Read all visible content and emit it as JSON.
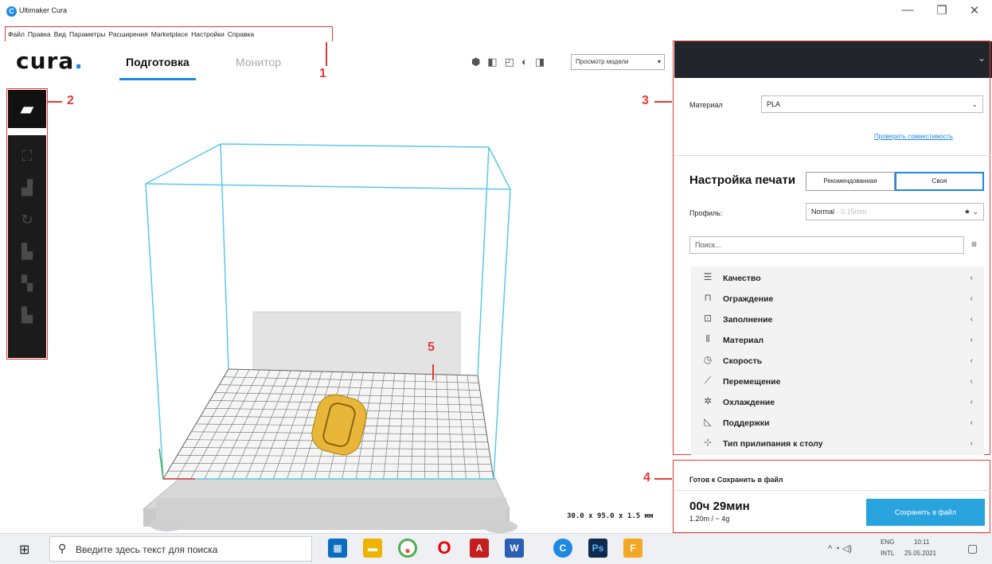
{
  "window": {
    "title": "Ultimaker Cura",
    "app_icon": "cura-icon",
    "controls": {
      "minimize": "—",
      "maximize": "❐",
      "close": "✕"
    }
  },
  "menu": [
    "Файл",
    "Правка",
    "Вид",
    "Параметры",
    "Расширения",
    "Marketplace",
    "Настройки",
    "Справка"
  ],
  "header": {
    "logo": "cura",
    "tabs": [
      {
        "label": "Подготовка",
        "active": true
      },
      {
        "label": "Монитор",
        "active": false
      }
    ],
    "view_icons": [
      "3d-view-icon",
      "front-view-icon",
      "top-view-icon",
      "left-view-icon",
      "right-view-icon"
    ],
    "view_mode": "Просмотр модели"
  },
  "toolbar": [
    "open-file-icon",
    "move-icon",
    "scale-icon",
    "rotate-icon",
    "mirror-icon",
    "per-model-settings-icon",
    "support-blocker-icon"
  ],
  "callouts": [
    "1",
    "2",
    "3",
    "4",
    "5"
  ],
  "model_dimensions": "30.0 x 95.0 x 1.5 мм",
  "printer_panel": {
    "material_label": "Материал",
    "material_value": "PLA",
    "compat_link": "Проверить совместимость"
  },
  "print_settings": {
    "title": "Настройка печати",
    "mode_recommended": "Рекомендованная",
    "mode_custom": "Своя",
    "profile_label": "Профиль:",
    "profile_value": "Normal",
    "profile_detail": "- 0.15mm",
    "search_placeholder": "Поиск...",
    "categories": [
      {
        "label": "Качество",
        "icon": "quality-icon"
      },
      {
        "label": "Ограждение",
        "icon": "shell-icon"
      },
      {
        "label": "Заполнение",
        "icon": "infill-icon"
      },
      {
        "label": "Материал",
        "icon": "material-icon"
      },
      {
        "label": "Скорость",
        "icon": "speed-icon"
      },
      {
        "label": "Перемещение",
        "icon": "travel-icon"
      },
      {
        "label": "Охлаждение",
        "icon": "cooling-icon"
      },
      {
        "label": "Поддержки",
        "icon": "support-icon"
      },
      {
        "label": "Тип прилипания к столу",
        "icon": "adhesion-icon"
      }
    ]
  },
  "output": {
    "status": "Готов к Сохранить в файл",
    "time": "00ч 29мин",
    "material": "1.20m / ~ 4g",
    "save_button": "Сохранить в файл"
  },
  "taskbar": {
    "search_placeholder": "Введите здесь текст для поиска",
    "apps": [
      "calculator-icon",
      "file-explorer-icon",
      "chrome-icon",
      "opera-icon",
      "acrobat-icon",
      "word-icon",
      "cura-icon",
      "photoshop-icon",
      "fusion-icon"
    ],
    "lang": "ENG",
    "layout": "INTL",
    "time": "10:11",
    "date": "25.05.2021"
  },
  "colors": {
    "accent": "#1e88e5",
    "annotation": "#e53935",
    "build_volume": "#5bc8e8",
    "model": "#e8b739",
    "panel_dark": "#22252b",
    "save_button": "#29a3dd"
  }
}
